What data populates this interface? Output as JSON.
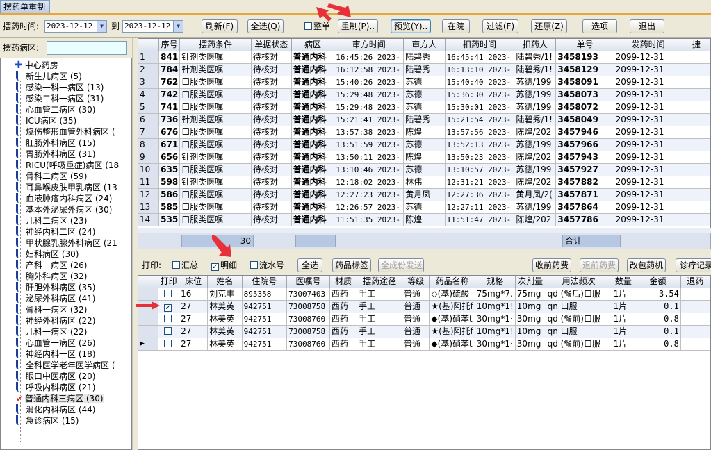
{
  "window": {
    "tab_title": "摆药单重制"
  },
  "toolbar": {
    "date_label": "摆药时间:",
    "date_from": "2023-12-12",
    "to_label": "到",
    "date_to": "2023-12-12",
    "refresh": "刷新(F)",
    "select_all": "全选(Q)",
    "whole_label": "整单",
    "remake": "重制(P)..",
    "preview": "预览(Y)..",
    "in_hospital": "在院",
    "filter": "过滤(F)",
    "restore": "还原(Z)",
    "options": "选项",
    "exit": "退出"
  },
  "sidebar": {
    "ward_label": "摆药病区:",
    "ward_value": "",
    "root": "中心药房",
    "items": [
      "新生儿病区 (5)",
      "感染一科一病区 (13)",
      "感染二科一病区 (31)",
      "心血管二病区 (30)",
      "ICU病区 (35)",
      "烧伤整形血管外科病区 (",
      "肛肠外科病区 (15)",
      "胃肠外科病区 (31)",
      "RICU(呼吸重症)病区 (18",
      "骨科二病区 (59)",
      "耳鼻喉皮肤甲乳病区 (13",
      "血液肿瘤内科病区 (24)",
      "基本外泌尿外病区 (30)",
      "儿科二病区 (23)",
      "神经内科二区 (24)",
      "甲状腺乳腺外科病区 (21",
      "妇科病区 (30)",
      "产科一病区 (26)",
      "胸外科病区 (32)",
      "肝胆外科病区 (35)",
      "泌尿外科病区 (41)",
      "骨科一病区 (32)",
      "神经外科病区 (22)",
      "儿科一病区 (22)",
      "心血管一病区 (26)",
      "神经内科一区 (18)",
      "全科医学老年医学病区 (",
      "眼口中医病区 (20)",
      "呼吸内科病区 (21)",
      "普通内科三病区 (30)",
      "消化内科病区 (44)",
      "急诊病区 (15)"
    ],
    "selected_index": 29
  },
  "top_grid": {
    "columns": [
      "序号",
      "摆药条件",
      "单据状态",
      "病区",
      "审方时间",
      "审方人",
      "扣药时间",
      "扣药人",
      "单号",
      "发药时间",
      "捷"
    ],
    "rows": [
      [
        "1",
        "841",
        "针剂类医嘱",
        "待核对",
        "普通内科",
        "16:45:26 2023-",
        "陆碧秀",
        "16:45:41 2023-",
        "陆碧秀/1!",
        "3458193",
        "2099-12-31"
      ],
      [
        "2",
        "784",
        "针剂类医嘱",
        "待核对",
        "普通内科",
        "16:12:58 2023-",
        "陆碧秀",
        "16:13:10 2023-",
        "陆碧秀/1!",
        "3458129",
        "2099-12-31"
      ],
      [
        "3",
        "762",
        "口服类医嘱",
        "待核对",
        "普通内科",
        "15:40:26 2023-",
        "苏德",
        "15:40:40 2023-",
        "苏德/199",
        "3458091",
        "2099-12-31"
      ],
      [
        "4",
        "742",
        "口服类医嘱",
        "待核对",
        "普通内科",
        "15:29:48 2023-",
        "苏德",
        "15:36:30 2023-",
        "苏德/199",
        "3458073",
        "2099-12-31"
      ],
      [
        "5",
        "741",
        "口服类医嘱",
        "待核对",
        "普通内科",
        "15:29:48 2023-",
        "苏德",
        "15:30:01 2023-",
        "苏德/199",
        "3458072",
        "2099-12-31"
      ],
      [
        "6",
        "736",
        "针剂类医嘱",
        "待核对",
        "普通内科",
        "15:21:41 2023-",
        "陆碧秀",
        "15:21:54 2023-",
        "陆碧秀/1!",
        "3458049",
        "2099-12-31"
      ],
      [
        "7",
        "676",
        "口服类医嘱",
        "待核对",
        "普通内科",
        "13:57:38 2023-",
        "陈煌",
        "13:57:56 2023-",
        "陈煌/202",
        "3457946",
        "2099-12-31"
      ],
      [
        "8",
        "671",
        "口服类医嘱",
        "待核对",
        "普通内科",
        "13:51:59 2023-",
        "苏德",
        "13:52:13 2023-",
        "苏德/199",
        "3457966",
        "2099-12-31"
      ],
      [
        "9",
        "656",
        "针剂类医嘱",
        "待核对",
        "普通内科",
        "13:50:11 2023-",
        "陈煌",
        "13:50:23 2023-",
        "陈煌/202",
        "3457943",
        "2099-12-31"
      ],
      [
        "10",
        "635",
        "口服类医嘱",
        "待核对",
        "普通内科",
        "13:10:46 2023-",
        "苏德",
        "13:10:57 2023-",
        "苏德/199",
        "3457927",
        "2099-12-31"
      ],
      [
        "11",
        "598",
        "针剂类医嘱",
        "待核对",
        "普通内科",
        "12:18:02 2023-",
        "林伟",
        "12:31:21 2023-",
        "陈煌/202",
        "3457882",
        "2099-12-31"
      ],
      [
        "12",
        "586",
        "口服类医嘱",
        "待核对",
        "普通内科",
        "12:27:23 2023-",
        "黄月凤",
        "12:27:36 2023-",
        "黄月凤/2(",
        "3457871",
        "2099-12-31"
      ],
      [
        "13",
        "585",
        "口服类医嘱",
        "待核对",
        "普通内科",
        "12:26:57 2023-",
        "苏德",
        "12:27:11 2023-",
        "苏德/199",
        "3457864",
        "2099-12-31"
      ],
      [
        "14",
        "535",
        "口服类医嘱",
        "待核对",
        "普通内科",
        "11:51:35 2023-",
        "陈煌",
        "11:51:47 2023-",
        "陈煌/202",
        "3457786",
        "2099-12-31"
      ]
    ],
    "footer_count": "30",
    "footer_total": "合计"
  },
  "midbar": {
    "print_label": "打印:",
    "summary_label": "汇总",
    "detail_label": "明细",
    "serial_label": "流水号",
    "select_all": "全选",
    "drug_label": "药品标签",
    "all_send": "全成份发送",
    "recv_return": "收前药费",
    "refund": "退前药费",
    "change_machine": "改包药机",
    "clinic_record": "诊疗记录"
  },
  "bottom_grid": {
    "columns": [
      "打印",
      "床位",
      "姓名",
      "住院号",
      "医嘱号",
      "材质",
      "摆药途径",
      "等级",
      "药品名称",
      "规格",
      "次剂量",
      "用法频次",
      "数量",
      "金额",
      "退药"
    ],
    "rows": [
      {
        "marker": "",
        "checked": false,
        "cells": [
          "16",
          "刘克丰",
          "895358",
          "73007403",
          "西药",
          "手工",
          "普通",
          "◇(基)硫酸",
          "75mg*7.",
          "75mg",
          "qd (餐后)口服",
          "1片",
          "3.54"
        ]
      },
      {
        "marker": "",
        "checked": true,
        "cells": [
          "27",
          "林美英",
          "942751",
          "73008758",
          "西药",
          "手工",
          "普通",
          "★(基)阿托f",
          "10mg*1!",
          "10mg",
          "qn 口服",
          "1片",
          "0.1"
        ]
      },
      {
        "marker": "",
        "checked": false,
        "cells": [
          "27",
          "林美英",
          "942751",
          "73008760",
          "西药",
          "手工",
          "普通",
          "◆(基)硝苯t",
          "30mg*1·",
          "30mg",
          "qd (餐前)口服",
          "1片",
          "0.8"
        ]
      },
      {
        "marker": "",
        "checked": false,
        "cells": [
          "27",
          "林美英",
          "942751",
          "73008758",
          "西药",
          "手工",
          "普通",
          "★(基)阿托f",
          "10mg*1!",
          "10mg",
          "qn 口服",
          "1片",
          "0.1"
        ]
      },
      {
        "marker": "▶",
        "checked": false,
        "cells": [
          "27",
          "林美英",
          "942751",
          "73008760",
          "西药",
          "手工",
          "普通",
          "◆(基)硝苯t",
          "30mg*1·",
          "30mg",
          "qd (餐前)口服",
          "1片",
          "0.8"
        ]
      }
    ]
  },
  "colors": {
    "accent": "#e9a43b",
    "row_alt": "#eef3fb",
    "header": "#dce3ee",
    "annotation_arrow": "#e8303a"
  }
}
